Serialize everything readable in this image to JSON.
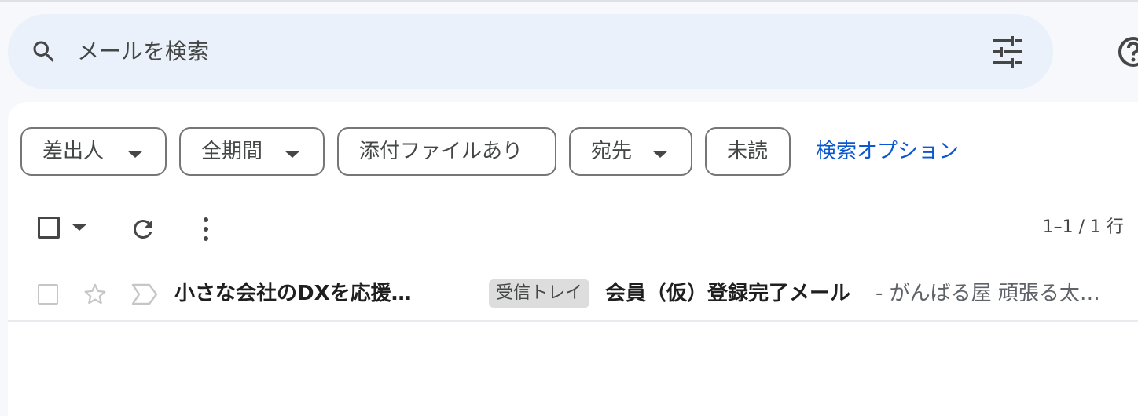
{
  "search": {
    "placeholder": "メールを検索",
    "search_icon": "search-icon",
    "options_icon": "tune-icon"
  },
  "header": {
    "help_icon": "help-icon"
  },
  "filters": {
    "chips": [
      {
        "label": "差出人",
        "dropdown": true
      },
      {
        "label": "全期間",
        "dropdown": true
      },
      {
        "label": "添付ファイルあり",
        "dropdown": false
      },
      {
        "label": "宛先",
        "dropdown": true
      },
      {
        "label": "未読",
        "dropdown": false
      }
    ],
    "search_options_label": "検索オプション"
  },
  "toolbar": {
    "select_icon": "checkbox-icon",
    "refresh_icon": "refresh-icon",
    "more_icon": "more-vert-icon",
    "count": "1–1 / 1 行"
  },
  "messages": [
    {
      "sender": "小さな会社のDXを応援…",
      "label": "受信トレイ",
      "subject": "会員（仮）登録完了メール",
      "snippet": " - がんばる屋 頑張る太…",
      "starred": false,
      "important": false
    }
  ],
  "colors": {
    "accent": "#0b57d0",
    "search_bg": "#eaf1fb",
    "page_bg": "#f6f8fc",
    "label_bg": "#dddddd"
  }
}
